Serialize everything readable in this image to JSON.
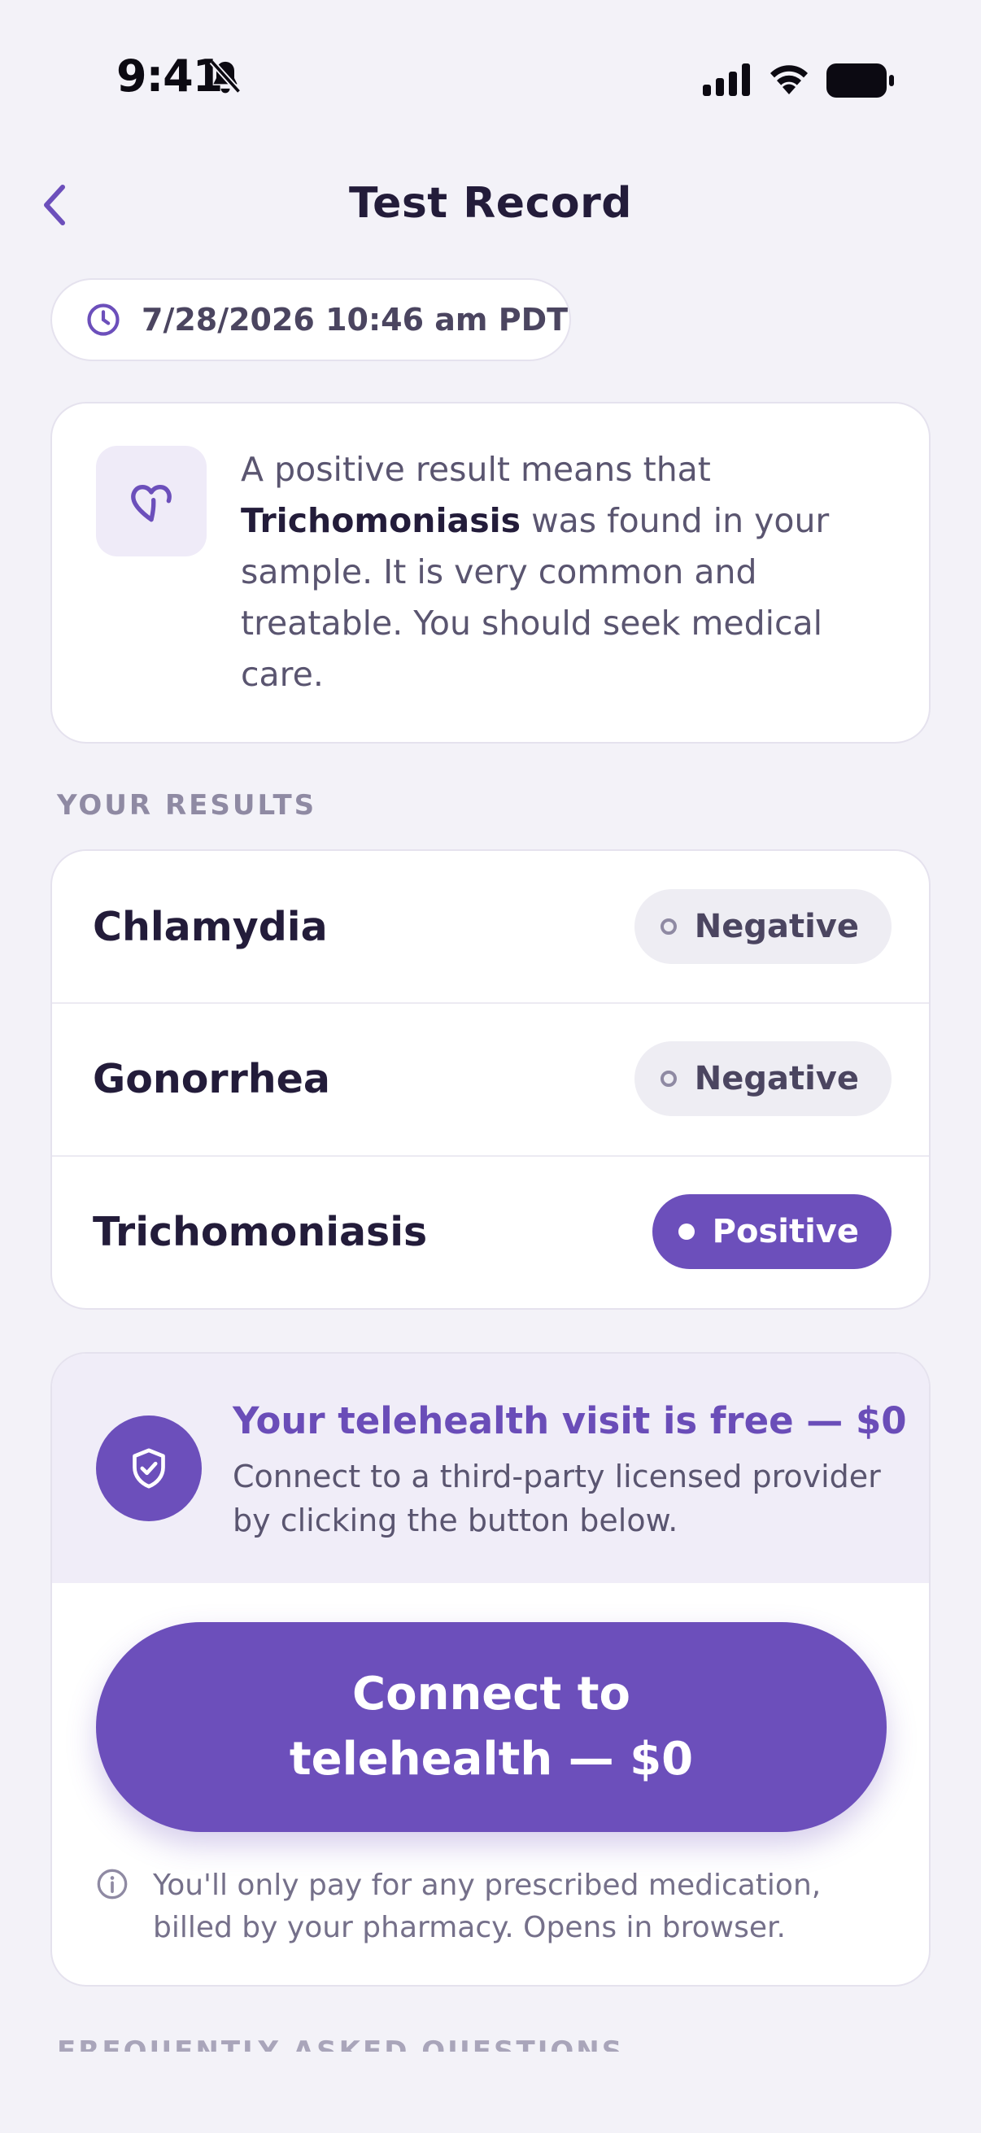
{
  "status_bar": {
    "time": "9:41",
    "icons": [
      "bell-off-icon",
      "signal-icon",
      "wifi-icon",
      "battery-icon"
    ]
  },
  "header": {
    "title": "Test Record",
    "back_icon": "chevron-left-icon"
  },
  "date_pill": {
    "icon": "clock-icon",
    "text": "7/28/2026 10:46 am PDT"
  },
  "info": {
    "icon": "heart-icon",
    "text_before": "A positive result means that ",
    "highlight": "Trichomoniasis",
    "text_after": " was found in your sample. It is very common and treatable. You should seek medical care."
  },
  "results": {
    "section_label": "YOUR RESULTS",
    "items": [
      {
        "name": "Chlamydia",
        "status": "Negative"
      },
      {
        "name": "Gonorrhea",
        "status": "Negative"
      },
      {
        "name": "Trichomoniasis",
        "status": "Positive"
      }
    ]
  },
  "telehealth": {
    "icon": "shield-check-icon",
    "title": "Your telehealth visit is free — $0",
    "subtitle": "Connect to a third-party licensed provider by clicking the button below.",
    "button_label": "Connect to telehealth — $0",
    "note_icon": "info-icon",
    "note": "You'll only pay for any prescribed medication, billed by your pharmacy. Opens in browser."
  },
  "faq": {
    "section_label": "FREQUENTLY ASKED QUESTIONS"
  },
  "colors": {
    "accent": "#6C4FBB",
    "background": "#F3F2F8",
    "card": "#FFFFFF",
    "negative_badge": "#EEEDF3"
  }
}
